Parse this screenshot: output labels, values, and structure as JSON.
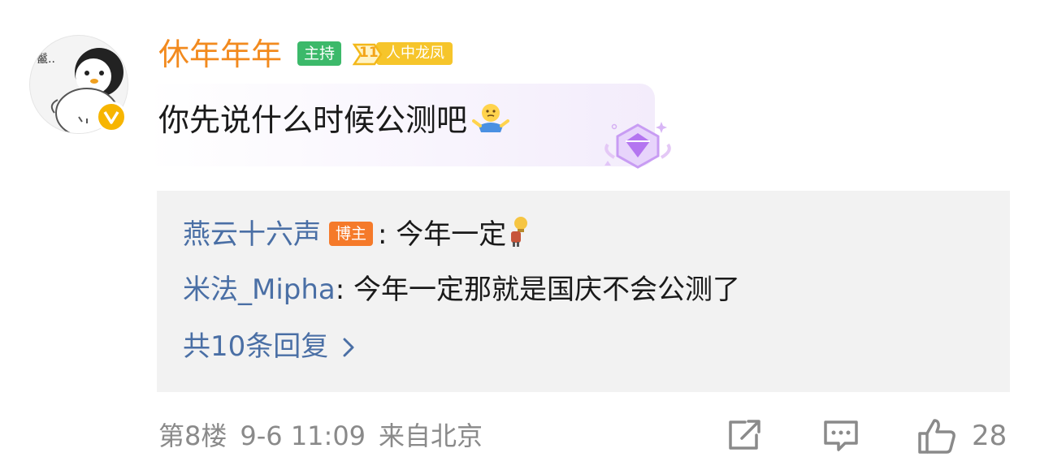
{
  "comment": {
    "author": {
      "name": "休年年年",
      "avatar_text": "鬣..",
      "verified_icon": "verified-v-badge",
      "badges": {
        "host": "主持",
        "level_number": "11",
        "level_title": "人中龙凤"
      }
    },
    "text": "你先说什么时候公测吧",
    "emoji": "shrug-emoji"
  },
  "replies": {
    "items": [
      {
        "author": "燕云十六声",
        "badge": "博主",
        "separator": ":",
        "text": "今年一定"
      },
      {
        "author": "米法_Mipha",
        "separator": ":",
        "text": "今年一定那就是国庆不会公测了"
      }
    ],
    "more_label": "共10条回复"
  },
  "footer": {
    "floor": "第8楼",
    "time": "9-6 11:09",
    "location": "来自北京",
    "like_count": "28"
  },
  "colors": {
    "username": "#f28a1e",
    "reply_link": "#4a6fa5",
    "host_badge": "#3cb96a",
    "blogger_badge": "#f57a2a",
    "level_badge": "#f6c52b"
  }
}
